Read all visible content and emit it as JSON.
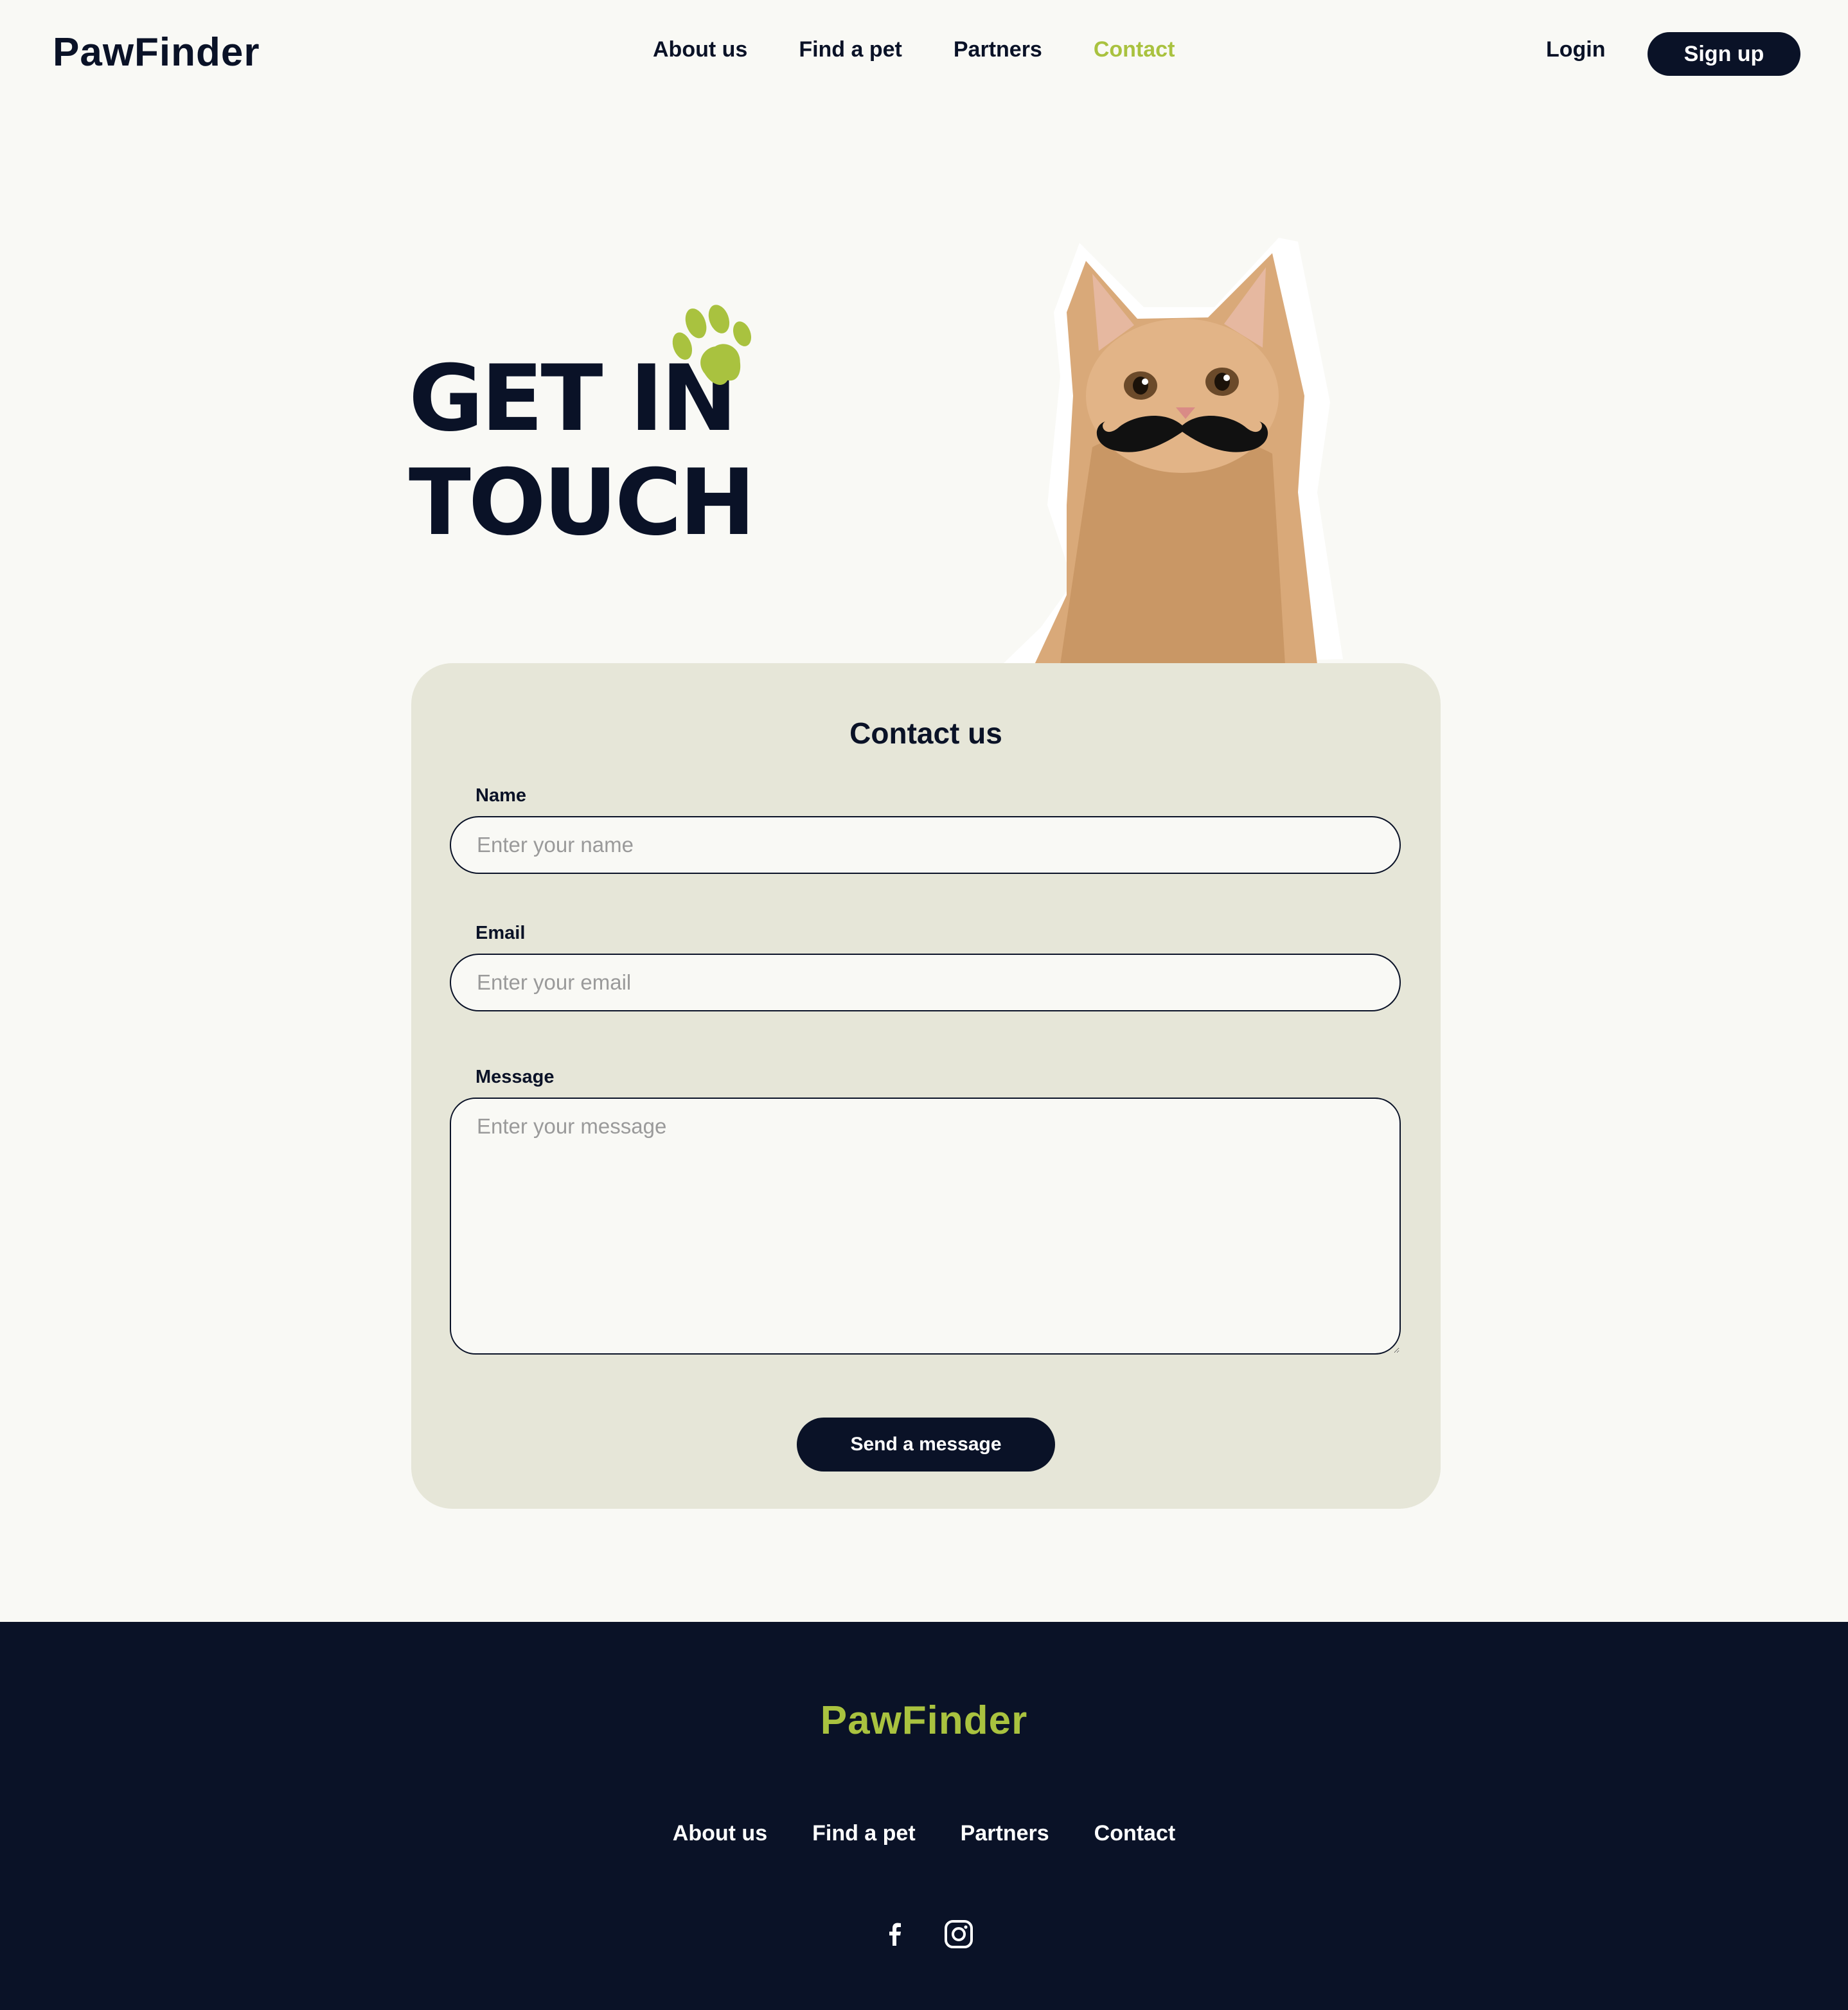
{
  "brand": {
    "name": "PawFinder"
  },
  "nav": {
    "items": [
      {
        "label": "About us"
      },
      {
        "label": "Find a pet"
      },
      {
        "label": "Partners"
      },
      {
        "label": "Contact"
      }
    ],
    "active": "Contact",
    "login_label": "Login",
    "signup_label": "Sign up"
  },
  "hero": {
    "title_line1": "GET IN",
    "title_line2": "TOUCH",
    "paw_icon": "paw-print-icon",
    "image_alt": "kitten-with-mustache"
  },
  "form": {
    "title": "Contact us",
    "name_label": "Name",
    "name_placeholder": "Enter your name",
    "email_label": "Email",
    "email_placeholder": "Enter your email",
    "message_label": "Message",
    "message_placeholder": "Enter your message",
    "submit_label": "Send a message"
  },
  "footer": {
    "brand": "PawFinder",
    "links": [
      {
        "label": "About us"
      },
      {
        "label": "Find a pet"
      },
      {
        "label": "Partners"
      },
      {
        "label": "Contact"
      }
    ],
    "social": [
      "facebook-icon",
      "instagram-icon"
    ]
  },
  "colors": {
    "background": "#f9f9f5",
    "navy": "#0a1227",
    "accent": "#a9c23f",
    "card": "#e6e6d8"
  }
}
